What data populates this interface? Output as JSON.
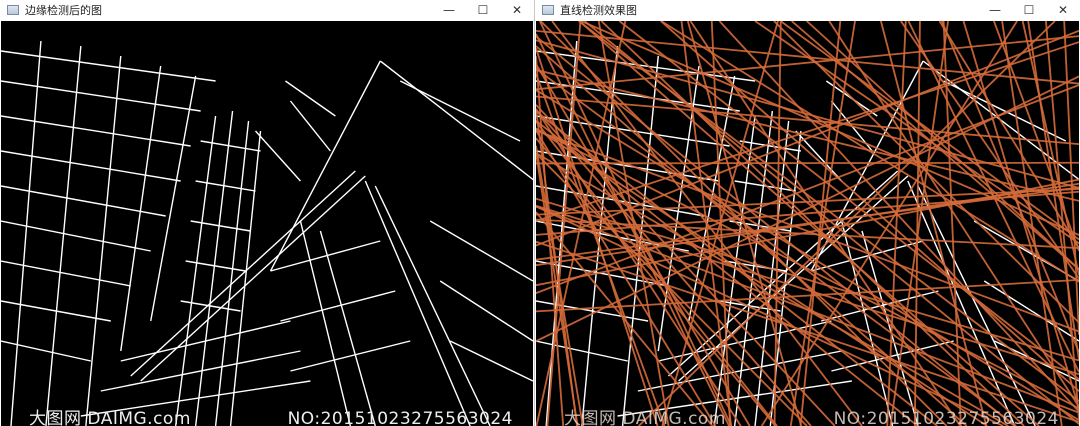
{
  "windows": [
    {
      "title": "边缘检测后的图",
      "controls": {
        "minimize": "—",
        "maximize": "☐",
        "close": "✕"
      },
      "watermark_site": "大图网 DAIMG.com",
      "watermark_no": "NO:20151023275563024"
    },
    {
      "title": "直线检测效果图",
      "controls": {
        "minimize": "—",
        "maximize": "☐",
        "close": "✕"
      },
      "watermark_site": "大图网 DAIMG.com",
      "watermark_no": "NO:20151023275563024"
    }
  ],
  "colors": {
    "edge_stroke": "#ffffff",
    "hough_line": "#d46a3a",
    "canvas_bg": "#000000"
  }
}
